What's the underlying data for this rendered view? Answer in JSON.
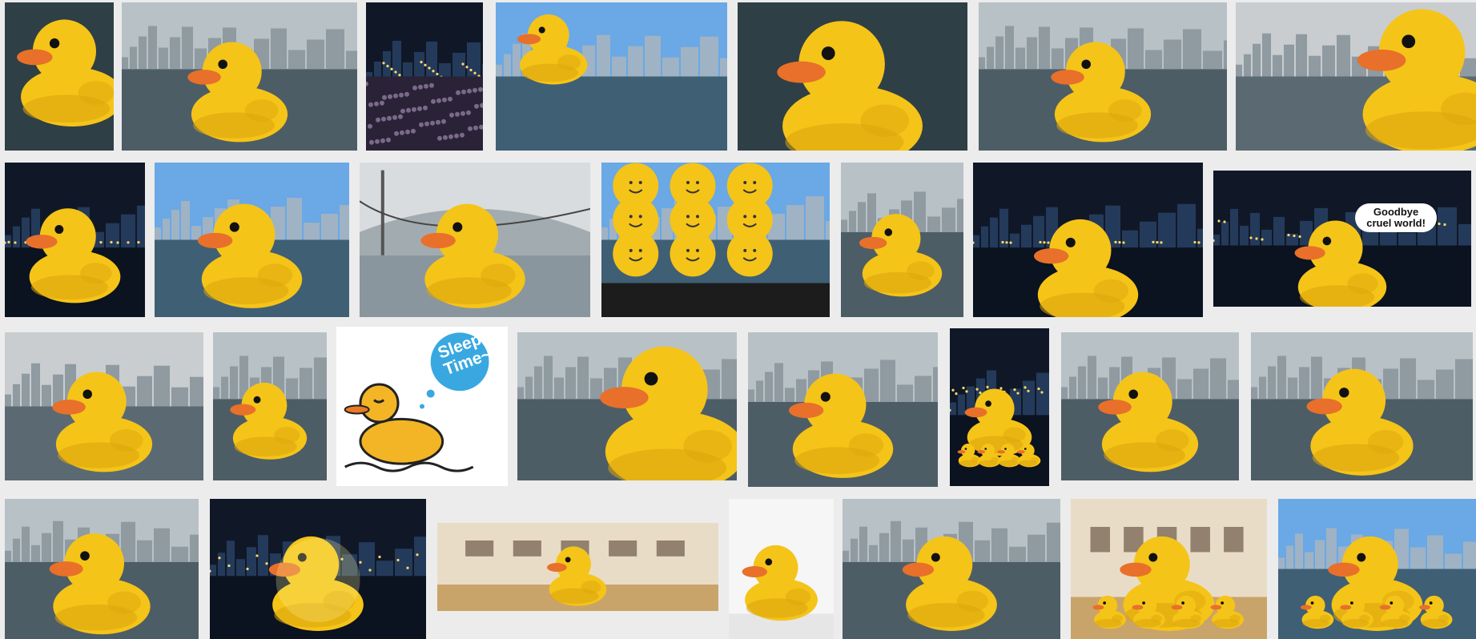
{
  "grid": {
    "background": "#ececec",
    "duck_colors": {
      "body": "#f5c418",
      "shade": "#d9a40c",
      "beak": "#e8702a",
      "eye": "#111111"
    }
  },
  "tiles": [
    {
      "scene": "water",
      "icon": "rubber-duck-closeup"
    },
    {
      "scene": "harbor",
      "icon": "rubber-duck-harbor"
    },
    {
      "scene": "night",
      "icon": "crowd-night"
    },
    {
      "scene": "sky",
      "icon": "rubber-duck-crowd"
    },
    {
      "scene": "water",
      "icon": "rubber-duck-front"
    },
    {
      "scene": "harbor",
      "icon": "rubber-duck-pier"
    },
    {
      "scene": "pier",
      "icon": "rubber-duck-terminal"
    },
    {
      "scene": "night",
      "icon": "rubber-duck-night"
    },
    {
      "scene": "sky",
      "icon": "rubber-duck-skyscrapers"
    },
    {
      "scene": "bridge",
      "icon": "rubber-duck-bridge"
    },
    {
      "scene": "sky",
      "icon": "smiley-balloons"
    },
    {
      "scene": "harbor",
      "icon": "rubber-duck-skyline"
    },
    {
      "scene": "night",
      "icon": "rubber-duck-deflated"
    },
    {
      "scene": "night",
      "icon": "rubber-duck-goodbye",
      "caption": "Goodbye cruel world!"
    },
    {
      "scene": "pier",
      "icon": "rubber-duck-silhouettes"
    },
    {
      "scene": "harbor",
      "icon": "rubber-duck-side"
    },
    {
      "scene": "white",
      "icon": "sleepy-duck-cartoon",
      "caption": "Sleepy Time~"
    },
    {
      "scene": "harbor",
      "icon": "rubber-duck-profile"
    },
    {
      "scene": "harbor",
      "icon": "duck-mascot-doll"
    },
    {
      "scene": "night",
      "icon": "mini-ducks-display"
    },
    {
      "scene": "harbor",
      "icon": "rubber-duck-city"
    },
    {
      "scene": "harbor",
      "icon": "rubber-duck-guard"
    },
    {
      "scene": "harbor",
      "icon": "rubber-duck-cruise-ship"
    },
    {
      "scene": "night",
      "icon": "rubber-duck-glowing"
    },
    {
      "scene": "gallery",
      "icon": "duck-gallery-hall"
    },
    {
      "scene": "white",
      "icon": "rubber-duck-small"
    },
    {
      "scene": "harbor",
      "icon": "rubber-duck-ifc"
    },
    {
      "scene": "gallery",
      "icon": "duck-ball-pit"
    },
    {
      "scene": "sky",
      "icon": "mini-ducks-promenade"
    }
  ]
}
